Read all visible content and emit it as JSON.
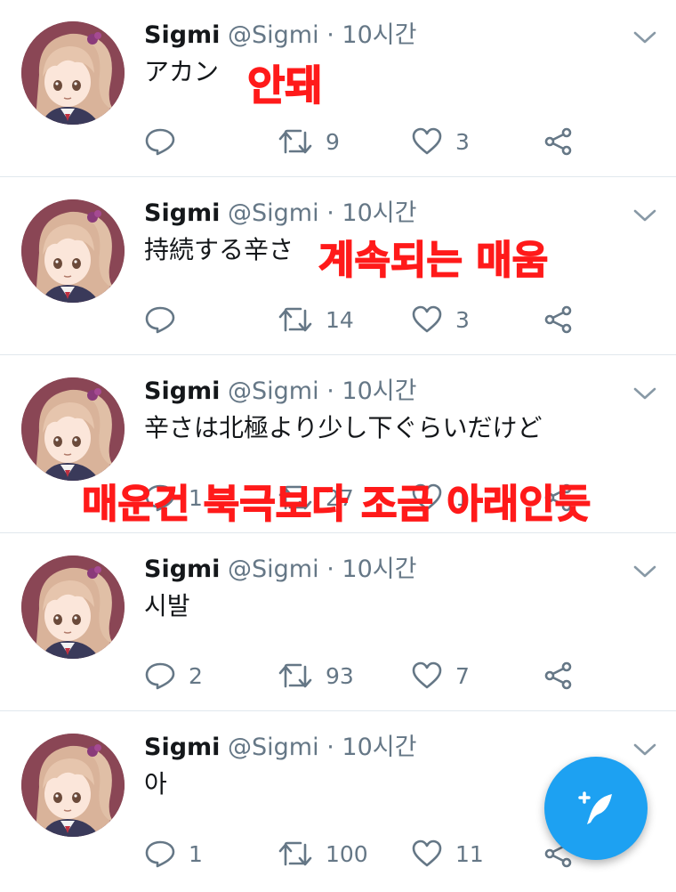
{
  "tweets": [
    {
      "name": "Sigmi",
      "handle": "@Sigmi",
      "dot": "·",
      "time": "10시간",
      "text": "アカン",
      "replies": "",
      "retweets": "9",
      "likes": "3"
    },
    {
      "name": "Sigmi",
      "handle": "@Sigmi",
      "dot": "·",
      "time": "10시간",
      "text": "持続する辛さ",
      "replies": "",
      "retweets": "14",
      "likes": "3"
    },
    {
      "name": "Sigmi",
      "handle": "@Sigmi",
      "dot": "·",
      "time": "10시간",
      "text": "辛さは北極より少し下ぐらいだけど",
      "replies": "1",
      "retweets": "27",
      "likes": "1"
    },
    {
      "name": "Sigmi",
      "handle": "@Sigmi",
      "dot": "·",
      "time": "10시간",
      "text": "시발",
      "replies": "2",
      "retweets": "93",
      "likes": "7"
    },
    {
      "name": "Sigmi",
      "handle": "@Sigmi",
      "dot": "·",
      "time": "10시간",
      "text": "아",
      "replies": "1",
      "retweets": "100",
      "likes": "11"
    }
  ],
  "overlays": {
    "t1": "안돼",
    "t2": "계속되는 매움",
    "t3": "매운건 북극보다 조금 아래인듯"
  },
  "icons": {
    "reply": "reply-icon",
    "retweet": "retweet-icon",
    "like": "heart-icon",
    "share": "share-icon",
    "caret": "chevron-down-icon",
    "compose": "compose-tweet-icon"
  },
  "colors": {
    "accent": "#1da1f2",
    "overlay_text": "#ff1a1a",
    "muted": "#657786"
  }
}
